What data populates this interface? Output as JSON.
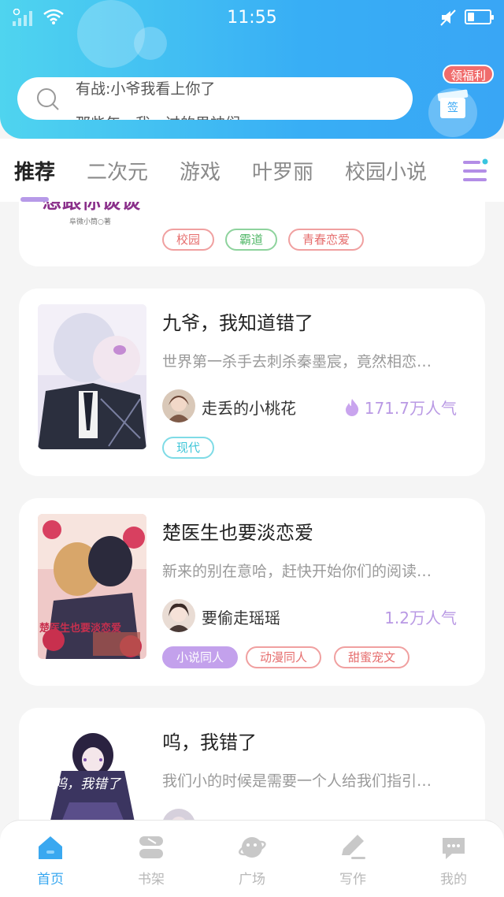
{
  "status_bar": {
    "time": "11:55",
    "battery_level_fraction": 0.3
  },
  "search": {
    "suggestions": [
      "有战:小爷我看上你了",
      "那些年，我…过的男神们"
    ]
  },
  "welfare": {
    "badge_label": "领福利",
    "gift_label": "签"
  },
  "tabs": [
    {
      "label": "推荐",
      "active": true
    },
    {
      "label": "二次元"
    },
    {
      "label": "游戏"
    },
    {
      "label": "叶罗丽"
    },
    {
      "label": "校园小说"
    }
  ],
  "books": [
    {
      "cover_text": "想跟你谈谈",
      "cover_sub": "阜微小筒○著",
      "tags": [
        "校园",
        "霸道",
        "青春恋爱"
      ]
    },
    {
      "title": "九爷，我知道错了",
      "desc": "世界第一杀手去刺杀秦墨宸，竟然相恋…",
      "author": "走丢的小桃花",
      "popularity": "171.7万人气",
      "tags": [
        "现代"
      ]
    },
    {
      "title": "楚医生也要淡恋爱",
      "desc": "新来的别在意哈，赶快开始你们的阅读…",
      "author": "要偷走瑶瑶",
      "popularity": "1.2万人气",
      "tags": [
        "小说同人",
        "动漫同人",
        "甜蜜宠文"
      ],
      "cover_text": "楚医生也要淡恋爱"
    },
    {
      "title": "呜，我错了",
      "desc": "我们小的时候是需要一个人给我们指引…",
      "author": "",
      "popularity": "",
      "tags": [],
      "cover_text": "呜，我错了"
    }
  ],
  "bottom_nav": [
    {
      "label": "首页",
      "icon": "home-icon",
      "active": true
    },
    {
      "label": "书架",
      "icon": "bookshelf-icon"
    },
    {
      "label": "广场",
      "icon": "planet-icon"
    },
    {
      "label": "写作",
      "icon": "pen-icon"
    },
    {
      "label": "我的",
      "icon": "chat-icon"
    }
  ],
  "colors": {
    "header_start": "#4fd4ef",
    "header_end": "#39a6f5",
    "accent": "#37a7f0",
    "purple": "#b999e4"
  }
}
